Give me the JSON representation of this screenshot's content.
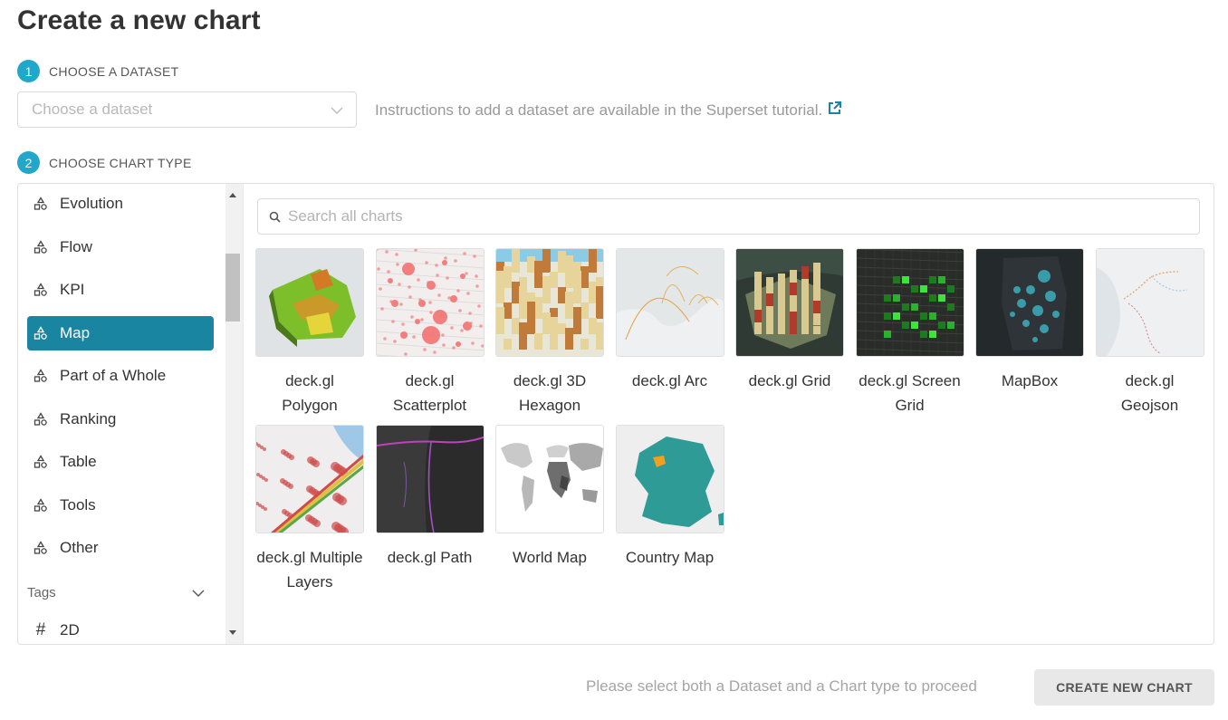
{
  "page": {
    "title": "Create a new chart"
  },
  "steps": [
    {
      "number": "1",
      "label": "CHOOSE A DATASET"
    },
    {
      "number": "2",
      "label": "CHOOSE CHART TYPE"
    }
  ],
  "dataset": {
    "placeholder": "Choose a dataset",
    "instructions": "Instructions to add a dataset are available in the Superset tutorial."
  },
  "categories": [
    {
      "label": "Evolution",
      "icon": "category-shapes-icon",
      "selected": false
    },
    {
      "label": "Flow",
      "icon": "category-shapes-icon",
      "selected": false
    },
    {
      "label": "KPI",
      "icon": "category-shapes-icon",
      "selected": false
    },
    {
      "label": "Map",
      "icon": "category-shapes-icon",
      "selected": true
    },
    {
      "label": "Part of a Whole",
      "icon": "category-shapes-icon",
      "selected": false
    },
    {
      "label": "Ranking",
      "icon": "category-shapes-icon",
      "selected": false
    },
    {
      "label": "Table",
      "icon": "category-shapes-icon",
      "selected": false
    },
    {
      "label": "Tools",
      "icon": "category-shapes-icon",
      "selected": false
    },
    {
      "label": "Other",
      "icon": "category-shapes-icon",
      "selected": false
    }
  ],
  "tags": {
    "label": "Tags",
    "items": [
      {
        "label": "2D",
        "icon": "hash-icon"
      }
    ]
  },
  "search": {
    "placeholder": "Search all charts"
  },
  "charts": [
    {
      "name": "deck.gl Polygon",
      "thumb": "polygon"
    },
    {
      "name": "deck.gl Scatterplot",
      "thumb": "scatter"
    },
    {
      "name": "deck.gl 3D Hexagon",
      "thumb": "hexagon"
    },
    {
      "name": "deck.gl Arc",
      "thumb": "arc"
    },
    {
      "name": "deck.gl Grid",
      "thumb": "grid"
    },
    {
      "name": "deck.gl Screen Grid",
      "thumb": "screengrid"
    },
    {
      "name": "MapBox",
      "thumb": "mapbox"
    },
    {
      "name": "deck.gl Geojson",
      "thumb": "geojson"
    },
    {
      "name": "deck.gl Multiple Layers",
      "thumb": "multilayer"
    },
    {
      "name": "deck.gl Path",
      "thumb": "path"
    },
    {
      "name": "World Map",
      "thumb": "world"
    },
    {
      "name": "Country Map",
      "thumb": "country"
    }
  ],
  "footer": {
    "message": "Please select both a Dataset and a Chart type to proceed",
    "button_label": "CREATE NEW CHART"
  },
  "colors": {
    "accent": "#1985a0",
    "step_badge": "#20a7c9"
  }
}
